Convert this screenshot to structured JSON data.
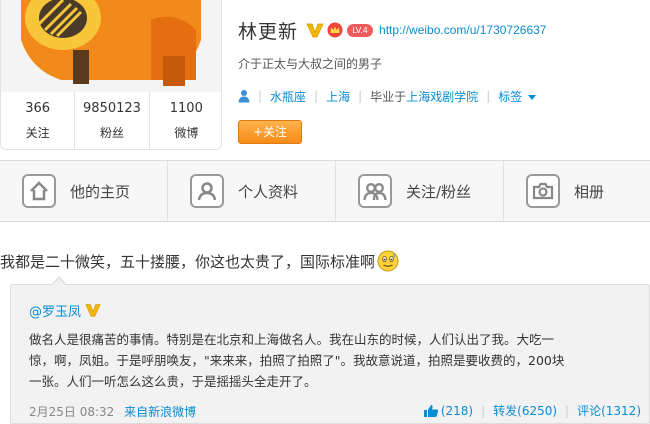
{
  "profile": {
    "name": "林更新",
    "level_badge": "LV.4",
    "url": "http://weibo.com/u/1730726637",
    "intro": "介于正太与大叔之间的男子",
    "zodiac": "水瓶座",
    "location": "上海",
    "education": "毕业于上海戏剧学院",
    "tags_label": "标签",
    "follow_button": "+关注",
    "stats": [
      {
        "num": "366",
        "label": "关注"
      },
      {
        "num": "9850123",
        "label": "粉丝"
      },
      {
        "num": "1100",
        "label": "微博"
      }
    ]
  },
  "tabs": [
    {
      "label": "他的主页",
      "icon": "home-icon"
    },
    {
      "label": "个人资料",
      "icon": "person-icon"
    },
    {
      "label": "关注/粉丝",
      "icon": "people-icon"
    },
    {
      "label": "相册",
      "icon": "camera-icon"
    }
  ],
  "post": {
    "text": "我都是二十微笑，五十搂腰，你这也太贵了，国际标准啊"
  },
  "repost": {
    "author": "@罗玉凤",
    "lines": [
      "做名人是很痛苦的事情。特别是在北京和上海做名人。我在山东的时候，人们认出了我。大吃一",
      "惊，啊，凤姐。于是呼朋唤友，\"来来来，拍照了拍照了\"。我故意说道，拍照是要收费的，200块",
      "一张。人们一听怎么这么贵，于是摇摇头全走开了。"
    ],
    "time": "2月25日 08:32",
    "source": "来自新浪微博",
    "like": "(218)",
    "forward": "转发(6250)",
    "comment": "评论(1312)"
  },
  "colors": {
    "link": "#0a8cd2",
    "follow_button": "#f68b17",
    "level_badge": "#f05a5a",
    "verified": "#f5b800"
  }
}
